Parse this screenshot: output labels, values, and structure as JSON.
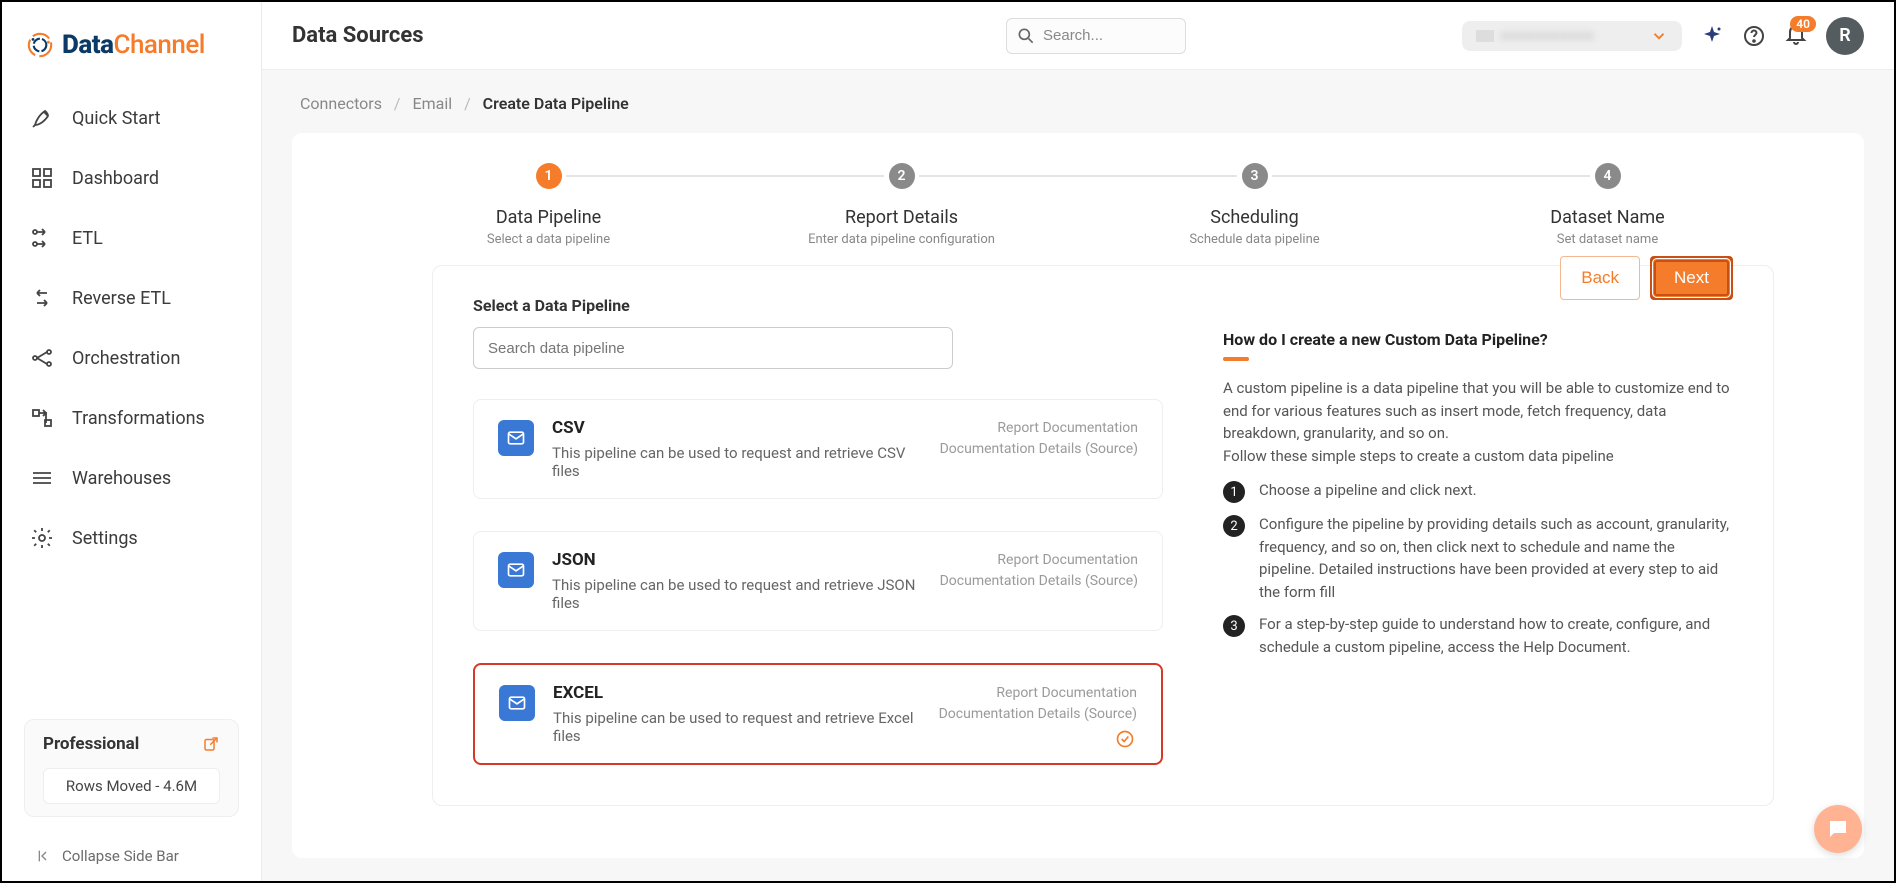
{
  "brand": {
    "name1": "Data",
    "name2": "Channel"
  },
  "sidebar": {
    "items": [
      {
        "label": "Quick Start"
      },
      {
        "label": "Dashboard"
      },
      {
        "label": "ETL"
      },
      {
        "label": "Reverse ETL"
      },
      {
        "label": "Orchestration"
      },
      {
        "label": "Transformations"
      },
      {
        "label": "Warehouses"
      },
      {
        "label": "Settings"
      }
    ],
    "plan": {
      "name": "Professional",
      "rows": "Rows Moved - 4.6M"
    },
    "collapse": "Collapse Side Bar"
  },
  "topbar": {
    "title": "Data Sources",
    "search_placeholder": "Search...",
    "org_name": "————————",
    "badge": "40",
    "avatar": "R"
  },
  "breadcrumbs": [
    "Connectors",
    "Email",
    "Create Data Pipeline"
  ],
  "stepper": [
    {
      "num": "1",
      "label": "Data Pipeline",
      "sub": "Select a data pipeline"
    },
    {
      "num": "2",
      "label": "Report Details",
      "sub": "Enter data pipeline configuration"
    },
    {
      "num": "3",
      "label": "Scheduling",
      "sub": "Schedule data pipeline"
    },
    {
      "num": "4",
      "label": "Dataset Name",
      "sub": "Set dataset name"
    }
  ],
  "panel": {
    "title": "Select a Data Pipeline",
    "search_placeholder": "Search data pipeline",
    "back": "Back",
    "next": "Next",
    "pipes": [
      {
        "title": "CSV",
        "desc": "This pipeline can be used to request and retrieve CSV files",
        "doc1": "Report Documentation",
        "doc2": "Documentation Details (Source)"
      },
      {
        "title": "JSON",
        "desc": "This pipeline can be used to request and retrieve JSON files",
        "doc1": "Report Documentation",
        "doc2": "Documentation Details (Source)"
      },
      {
        "title": "EXCEL",
        "desc": "This pipeline can be used to request and retrieve Excel files",
        "doc1": "Report Documentation",
        "doc2": "Documentation Details (Source)"
      }
    ]
  },
  "help": {
    "title": "How do I create a new Custom Data Pipeline?",
    "p1": "A custom pipeline is a data pipeline that you will be able to customize end to end for various features such as insert mode, fetch frequency, data breakdown, granularity, and so on.",
    "p2": "Follow these simple steps to create a custom data pipeline",
    "steps": [
      "Choose a pipeline and click next.",
      "Configure the pipeline by providing details such as account, granularity, frequency, and so on, then click next to schedule and name the pipeline. Detailed instructions have been provided at every step to aid the form fill",
      "For a step-by-step guide to understand how to create, configure, and schedule a custom pipeline, access the Help Document."
    ]
  }
}
